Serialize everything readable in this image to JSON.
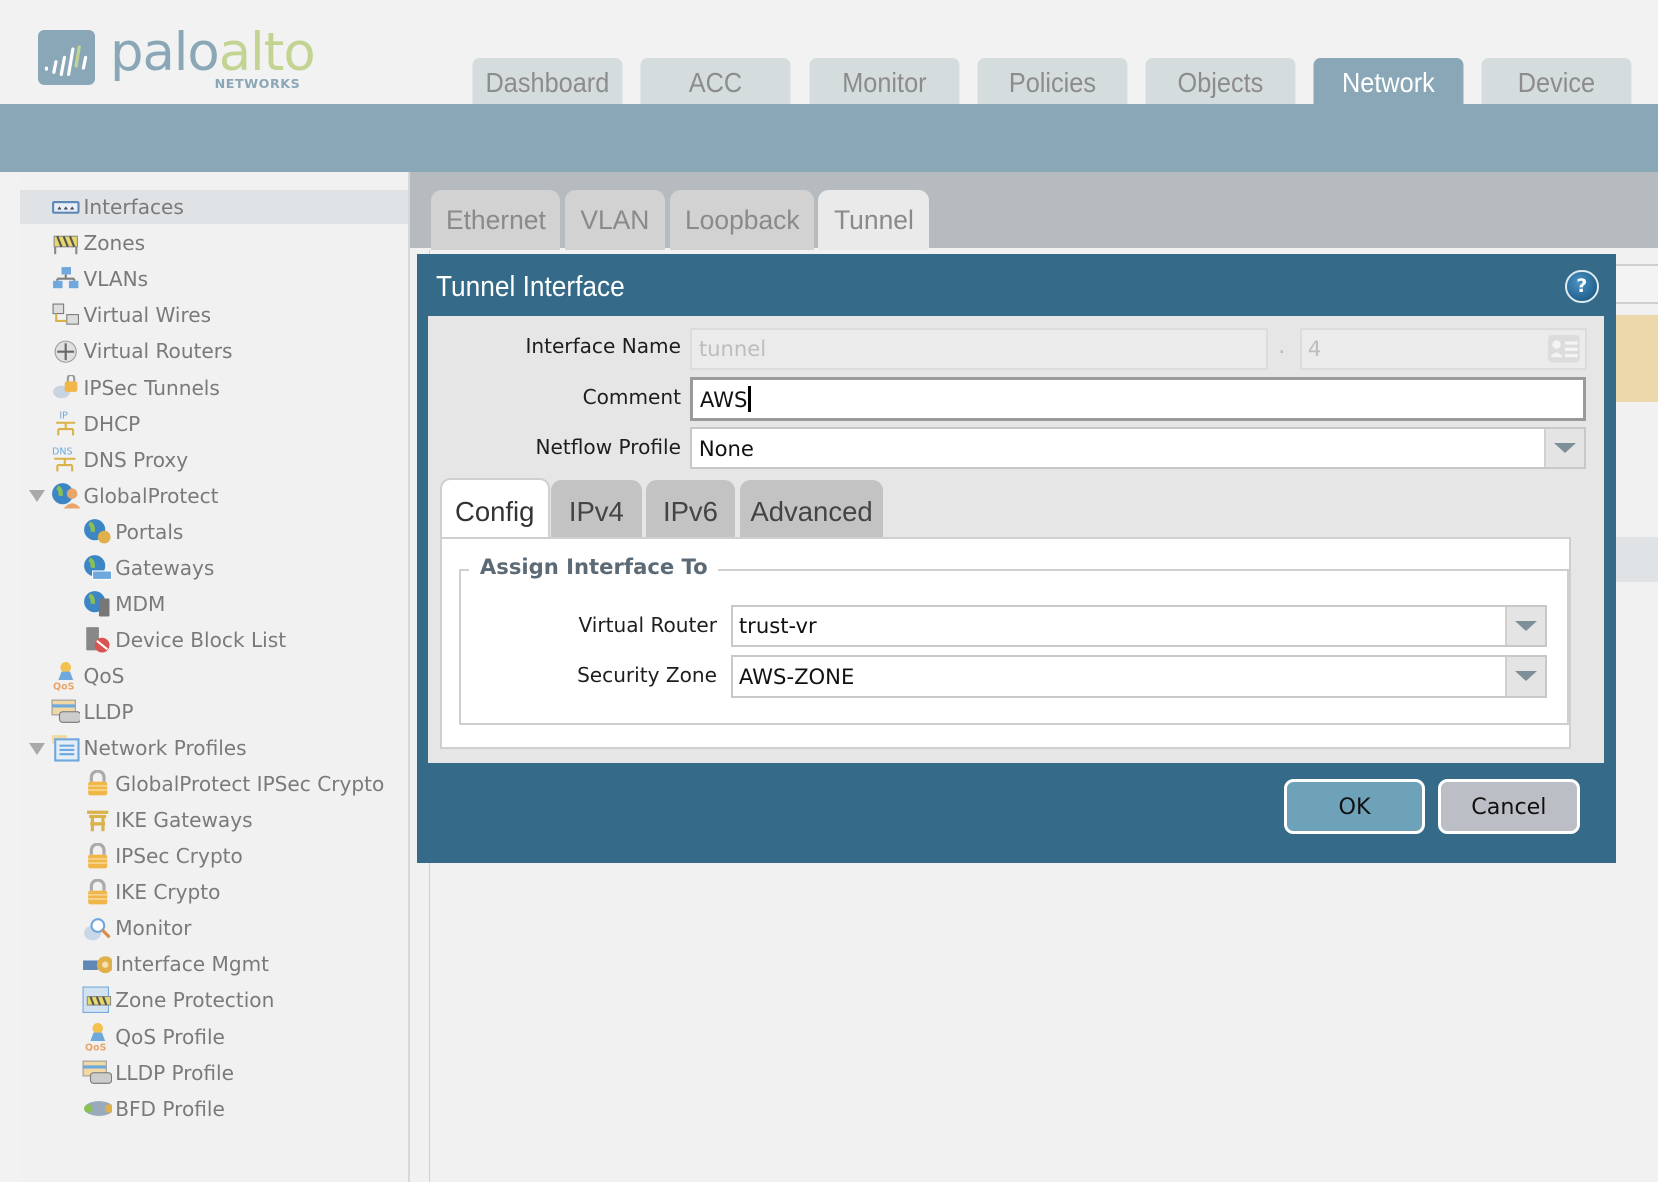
{
  "brand": {
    "name_part1": "palo",
    "name_part2": "alto",
    "subtitle": "NETWORKS"
  },
  "top_nav": {
    "tabs": [
      {
        "label": "Dashboard",
        "active": false
      },
      {
        "label": "ACC",
        "active": false
      },
      {
        "label": "Monitor",
        "active": false
      },
      {
        "label": "Policies",
        "active": false
      },
      {
        "label": "Objects",
        "active": false
      },
      {
        "label": "Network",
        "active": true
      },
      {
        "label": "Device",
        "active": false
      }
    ]
  },
  "sidebar": {
    "items": [
      {
        "label": "Interfaces",
        "icon": "interfaces-icon",
        "level": 0,
        "selected": true
      },
      {
        "label": "Zones",
        "icon": "zones-icon",
        "level": 0
      },
      {
        "label": "VLANs",
        "icon": "vlans-icon",
        "level": 0
      },
      {
        "label": "Virtual Wires",
        "icon": "virtual-wires-icon",
        "level": 0
      },
      {
        "label": "Virtual Routers",
        "icon": "virtual-routers-icon",
        "level": 0
      },
      {
        "label": "IPSec Tunnels",
        "icon": "ipsec-tunnels-icon",
        "level": 0
      },
      {
        "label": "DHCP",
        "icon": "dhcp-icon",
        "level": 0
      },
      {
        "label": "DNS Proxy",
        "icon": "dns-proxy-icon",
        "level": 0
      },
      {
        "label": "GlobalProtect",
        "icon": "globalprotect-icon",
        "level": 0,
        "expanded": true
      },
      {
        "label": "Portals",
        "icon": "portals-icon",
        "level": 1
      },
      {
        "label": "Gateways",
        "icon": "gateways-icon",
        "level": 1
      },
      {
        "label": "MDM",
        "icon": "mdm-icon",
        "level": 1
      },
      {
        "label": "Device Block List",
        "icon": "device-block-list-icon",
        "level": 1
      },
      {
        "label": "QoS",
        "icon": "qos-icon",
        "level": 0
      },
      {
        "label": "LLDP",
        "icon": "lldp-icon",
        "level": 0
      },
      {
        "label": "Network Profiles",
        "icon": "network-profiles-icon",
        "level": 0,
        "expanded": true
      },
      {
        "label": "GlobalProtect IPSec Crypto",
        "icon": "lock-icon",
        "level": 1
      },
      {
        "label": "IKE Gateways",
        "icon": "ike-gateways-icon",
        "level": 1
      },
      {
        "label": "IPSec Crypto",
        "icon": "lock-icon",
        "level": 1
      },
      {
        "label": "IKE Crypto",
        "icon": "lock-icon",
        "level": 1
      },
      {
        "label": "Monitor",
        "icon": "monitor-profile-icon",
        "level": 1
      },
      {
        "label": "Interface Mgmt",
        "icon": "interface-mgmt-icon",
        "level": 1
      },
      {
        "label": "Zone Protection",
        "icon": "zone-protection-icon",
        "level": 1
      },
      {
        "label": "QoS Profile",
        "icon": "qos-icon",
        "level": 1
      },
      {
        "label": "LLDP Profile",
        "icon": "lldp-icon",
        "level": 1
      },
      {
        "label": "BFD Profile",
        "icon": "bfd-profile-icon",
        "level": 1
      }
    ]
  },
  "sub_tabs": [
    {
      "label": "Ethernet",
      "active": false
    },
    {
      "label": "VLAN",
      "active": false
    },
    {
      "label": "Loopback",
      "active": false
    },
    {
      "label": "Tunnel",
      "active": true
    }
  ],
  "dialog": {
    "title": "Tunnel Interface",
    "help_glyph": "?",
    "fields": {
      "interface_name": {
        "label": "Interface Name",
        "value": "tunnel",
        "separator": ".",
        "suffix": "4"
      },
      "comment": {
        "label": "Comment",
        "value": "AWS"
      },
      "netflow_profile": {
        "label": "Netflow Profile",
        "value": "None"
      }
    },
    "tabs": [
      {
        "label": "Config",
        "active": true
      },
      {
        "label": "IPv4",
        "active": false
      },
      {
        "label": "IPv6",
        "active": false
      },
      {
        "label": "Advanced",
        "active": false
      }
    ],
    "assign": {
      "legend": "Assign Interface To",
      "virtual_router": {
        "label": "Virtual Router",
        "value": "trust-vr"
      },
      "security_zone": {
        "label": "Security Zone",
        "value": "AWS-ZONE"
      }
    },
    "buttons": {
      "ok": "OK",
      "cancel": "Cancel"
    }
  }
}
